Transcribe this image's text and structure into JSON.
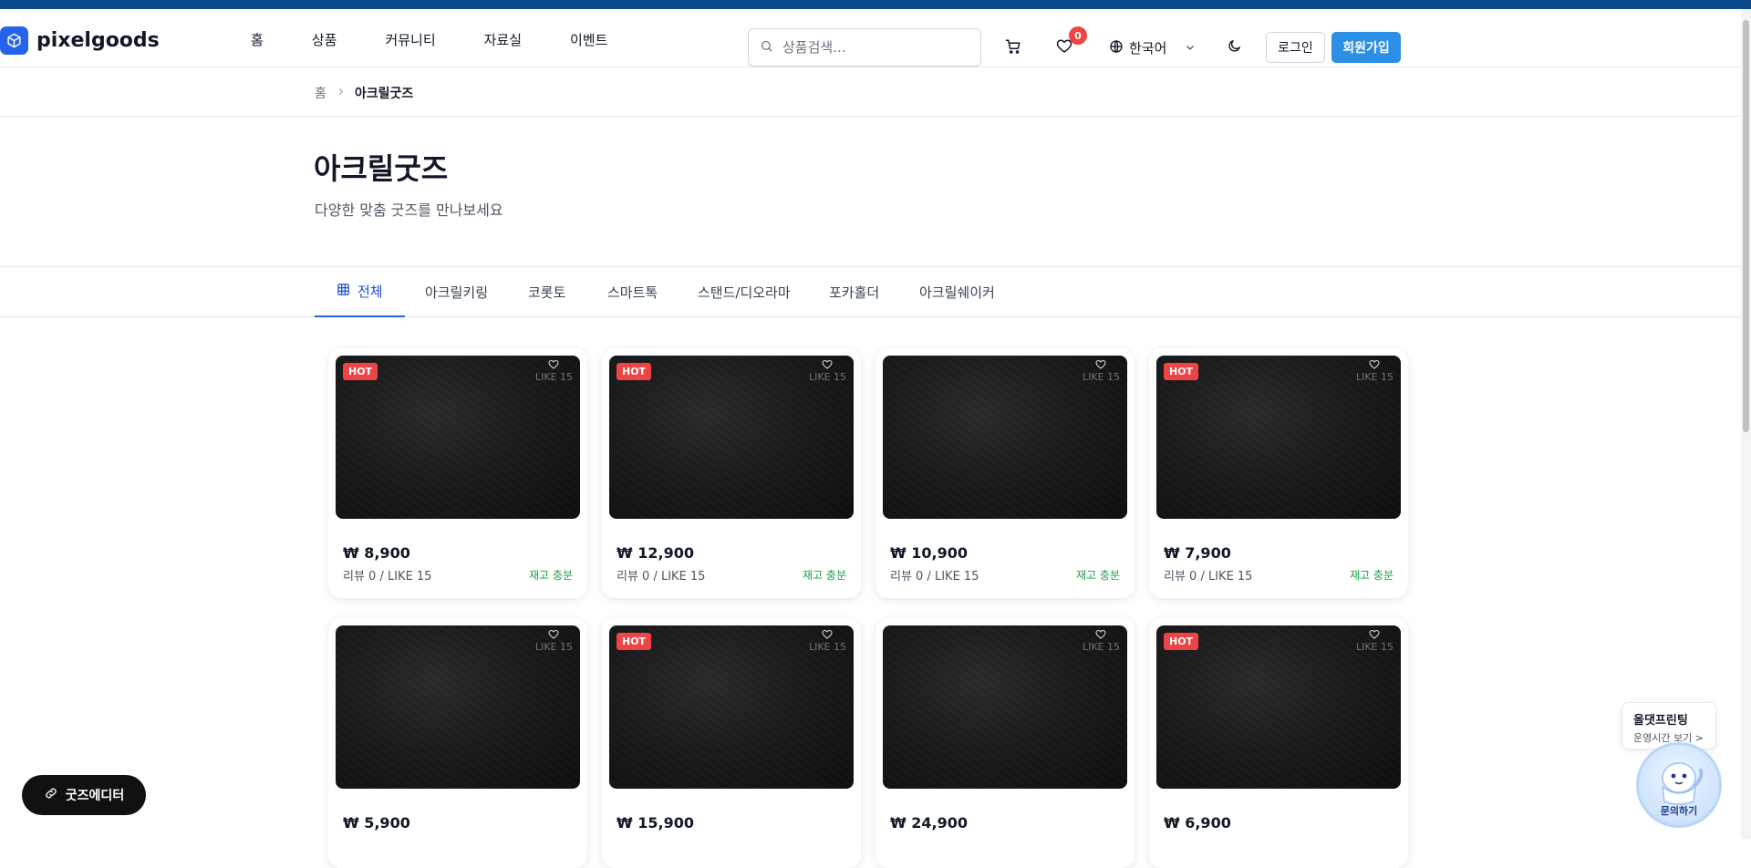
{
  "header": {
    "logo_text": "pixelgoods",
    "nav": [
      "홈",
      "상품",
      "커뮤니티",
      "자료실",
      "이벤트"
    ],
    "search_placeholder": "상품검색...",
    "wishlist_count": "0",
    "language": "한국어",
    "login_label": "로그인",
    "signup_label": "회원가입"
  },
  "breadcrumb": {
    "home": "홈",
    "current": "아크릴굿즈"
  },
  "hero": {
    "title": "아크릴굿즈",
    "subtitle": "다양한 맞춤 굿즈를 만나보세요"
  },
  "tabs": [
    "전체",
    "아크릴키링",
    "코롯토",
    "스마트톡",
    "스탠드/디오라마",
    "포카홀더",
    "아크릴쉐이커"
  ],
  "products": [
    {
      "price": "₩ 8,900",
      "hot": true,
      "like": "LIKE 15",
      "meta": "리뷰 0 / LIKE 15",
      "stock": "재고 충분"
    },
    {
      "price": "₩ 12,900",
      "hot": true,
      "like": "LIKE 15",
      "meta": "리뷰 0 / LIKE 15",
      "stock": "재고 충분"
    },
    {
      "price": "₩ 10,900",
      "hot": false,
      "like": "LIKE 15",
      "meta": "리뷰 0 / LIKE 15",
      "stock": "재고 충분"
    },
    {
      "price": "₩ 7,900",
      "hot": true,
      "like": "LIKE 15",
      "meta": "리뷰 0 / LIKE 15",
      "stock": "재고 충분"
    },
    {
      "price": "₩ 5,900",
      "hot": false,
      "like": "LIKE 15"
    },
    {
      "price": "₩ 15,900",
      "hot": true,
      "like": "LIKE 15"
    },
    {
      "price": "₩ 24,900",
      "hot": false,
      "like": "LIKE 15"
    },
    {
      "price": "₩ 6,900",
      "hot": true,
      "like": "LIKE 15"
    }
  ],
  "hot_label": "HOT",
  "floating": {
    "editor_label": "굿즈에디터",
    "chat_title": "올댓프린팅",
    "chat_sub": "운영시간 보기 >",
    "chat_label": "문의하기"
  },
  "colors": {
    "primary": "#2563eb",
    "signup": "#2b8fe6",
    "hot": "#ef4444",
    "stock": "#16a34a",
    "topbar": "#0b4a8b"
  }
}
